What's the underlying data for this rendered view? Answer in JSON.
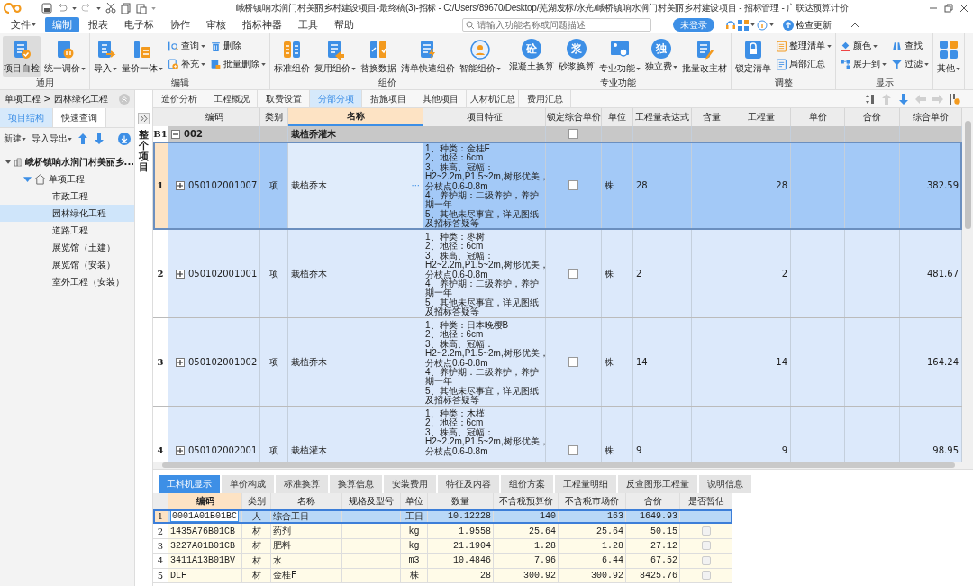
{
  "app": {
    "title": "峨桥镇响水涧门村美丽乡村建设项目-最终稿(3)-招标 - C:/Users/89670/Desktop/芜湖发标/永光/峨桥镇响水涧门村美丽乡村建设项目 - 招标管理 - 广联达预算计价"
  },
  "menu": {
    "items": [
      {
        "label": "文件",
        "menu": true,
        "selected": false
      },
      {
        "label": "编制",
        "menu": false,
        "selected": true
      },
      {
        "label": "报表",
        "menu": false,
        "selected": false
      },
      {
        "label": "电子标",
        "menu": false,
        "selected": false
      },
      {
        "label": "协作",
        "menu": false,
        "selected": false
      },
      {
        "label": "审核",
        "menu": false,
        "selected": false
      },
      {
        "label": "指标神器",
        "menu": false,
        "selected": false
      },
      {
        "label": "工具",
        "menu": false,
        "selected": false
      },
      {
        "label": "帮助",
        "menu": false,
        "selected": false
      }
    ],
    "search": {
      "placeholder": "请输入功能名称或问题描述"
    },
    "login": "未登录",
    "update": "检查更新"
  },
  "ribbon": [
    {
      "label": "通用",
      "columns": [
        {
          "kind": "large",
          "label": "项目自检",
          "menu": false,
          "pressed": true
        },
        {
          "kind": "large",
          "label": "统一调价",
          "menu": true,
          "pressed": false
        }
      ]
    },
    {
      "label": "编辑",
      "columns": [
        {
          "kind": "large",
          "label": "导入",
          "menu": true,
          "pressed": false
        },
        {
          "kind": "large",
          "label": "量价一体",
          "menu": true,
          "pressed": false
        },
        {
          "kind": "stack",
          "items": [
            {
              "label": "查询",
              "menu": true
            },
            {
              "label": "补充",
              "menu": true
            }
          ]
        },
        {
          "kind": "stack",
          "items": [
            {
              "label": "删除",
              "menu": false
            },
            {
              "label": "批量删除",
              "menu": true
            }
          ]
        }
      ]
    },
    {
      "label": "组价",
      "columns": [
        {
          "kind": "large",
          "label": "标准组价",
          "menu": false,
          "pressed": false
        },
        {
          "kind": "large",
          "label": "复用组价",
          "menu": true,
          "pressed": false
        },
        {
          "kind": "large",
          "label": "替换数据",
          "menu": false,
          "pressed": false
        },
        {
          "kind": "large",
          "label": "清单快速组价",
          "menu": false,
          "pressed": false
        },
        {
          "kind": "large",
          "label": "智能组价",
          "menu": true,
          "pressed": false
        }
      ]
    },
    {
      "label": "专业功能",
      "columns": [
        {
          "kind": "large",
          "label": "混凝土换算",
          "glyph": "砼",
          "menu": false,
          "pressed": false
        },
        {
          "kind": "large",
          "label": "砂浆换算",
          "glyph": "浆",
          "menu": false,
          "pressed": false
        },
        {
          "kind": "large",
          "label": "专业功能",
          "menu": true,
          "pressed": false
        },
        {
          "kind": "large",
          "label": "独立费",
          "glyph": "独",
          "menu": true,
          "pressed": false
        },
        {
          "kind": "large",
          "label": "批量改主材",
          "menu": false,
          "pressed": false
        }
      ]
    },
    {
      "label": "调整",
      "columns": [
        {
          "kind": "large",
          "label": "锁定清单",
          "menu": false,
          "pressed": false
        },
        {
          "kind": "stack",
          "items": [
            {
              "label": "整理清单",
              "menu": true
            },
            {
              "label": "局部汇总",
              "menu": false
            }
          ]
        }
      ]
    },
    {
      "label": "显示",
      "columns": [
        {
          "kind": "stack",
          "items": [
            {
              "label": "颜色",
              "menu": true
            },
            {
              "label": "展开到",
              "menu": true
            }
          ]
        },
        {
          "kind": "stack",
          "items": [
            {
              "label": "查找",
              "menu": false
            },
            {
              "label": "过滤",
              "menu": true
            }
          ]
        }
      ]
    },
    {
      "columns": [
        {
          "kind": "large",
          "label": "其他",
          "menu": true,
          "pressed": false
        }
      ]
    }
  ],
  "sidebar": {
    "breadcrumb": "单项工程 > 园林绿化工程",
    "tabs": [
      {
        "label": "项目结构",
        "selected": true
      },
      {
        "label": "快速查询",
        "selected": false
      }
    ],
    "toolbar": [
      {
        "label": "新建",
        "menu": true
      },
      {
        "label": "导入导出",
        "menu": true
      }
    ],
    "tree": [
      {
        "label": "峨桥镇响水涧门村美丽乡...",
        "kind": "project",
        "expanded": true,
        "selected": false,
        "children": [
          {
            "label": "单项工程",
            "kind": "single",
            "expanded": true,
            "selected": false,
            "children": [
              {
                "label": "市政工程",
                "selected": false
              },
              {
                "label": "园林绿化工程",
                "selected": true
              },
              {
                "label": "道路工程",
                "selected": false
              },
              {
                "label": "展览馆（土建）",
                "selected": false
              },
              {
                "label": "展览馆（安装）",
                "selected": false
              },
              {
                "label": "室外工程（安装）",
                "selected": false
              }
            ]
          }
        ]
      }
    ]
  },
  "side_strip": {
    "label": "整个项目"
  },
  "view_tabs": [
    {
      "label": "造价分析",
      "selected": false
    },
    {
      "label": "工程概况",
      "selected": false
    },
    {
      "label": "取费设置",
      "selected": false
    },
    {
      "label": "分部分项",
      "selected": true
    },
    {
      "label": "措施项目",
      "selected": false
    },
    {
      "label": "其他项目",
      "selected": false
    },
    {
      "label": "人材机汇总",
      "selected": false
    },
    {
      "label": "费用汇总",
      "selected": false
    }
  ],
  "table_toolbar": [
    {
      "kind": "sort",
      "disabled": false
    },
    {
      "kind": "up",
      "disabled": true
    },
    {
      "kind": "down",
      "disabled": false
    },
    {
      "kind": "left",
      "disabled": true
    },
    {
      "kind": "right",
      "disabled": true
    },
    {
      "kind": "columns",
      "disabled": false
    }
  ],
  "table": {
    "columns": [
      {
        "label": "编码",
        "selected": false
      },
      {
        "label": "类别",
        "selected": false
      },
      {
        "label": "名称",
        "selected": true
      },
      {
        "label": "项目特征",
        "selected": false
      },
      {
        "label": "锁定综合单价",
        "selected": false
      },
      {
        "label": "单位",
        "selected": false
      },
      {
        "label": "工程量表达式",
        "selected": false
      },
      {
        "label": "含量",
        "selected": false
      },
      {
        "label": "工程量",
        "selected": false
      },
      {
        "label": "单价",
        "selected": false
      },
      {
        "label": "合价",
        "selected": false
      },
      {
        "label": "综合单价",
        "selected": false
      }
    ],
    "section": {
      "index": "B1",
      "code": "002",
      "name": "栽植乔灌木",
      "expanded": true,
      "lock_checked": false
    },
    "rows": [
      {
        "index": "1",
        "code": "050102001007",
        "expanded": false,
        "type": "项",
        "name": "栽植乔木",
        "more": "···",
        "feature": [
          "1、种类：金桂F",
          "2、地径：6cm",
          "3、株高、冠幅：",
          "H2~2.2m,P1.5~2m,树形优美，",
          "分枝点0.6-0.8m",
          "4、养护期：二级养护，养护",
          "期一年",
          "5、其他未尽事宜，详见图纸",
          "及招标答疑等"
        ],
        "lock_checked": false,
        "unit": "株",
        "expression": "28",
        "quantity": "28",
        "composite_price": "382.59",
        "selected": true
      },
      {
        "index": "2",
        "code": "050102001001",
        "expanded": false,
        "type": "项",
        "name": "栽植乔木",
        "feature": [
          "1、种类：枣树",
          "2、地径：6cm",
          "3、株高、冠幅：",
          "H2~2.2m,P1.5~2m,树形优美，",
          "分枝点0.6-0.8m",
          "4、养护期：二级养护，养护",
          "期一年",
          "5、其他未尽事宜，详见图纸",
          "及招标答疑等"
        ],
        "lock_checked": false,
        "unit": "株",
        "expression": "2",
        "quantity": "2",
        "composite_price": "481.67",
        "selected": false
      },
      {
        "index": "3",
        "code": "050102001002",
        "expanded": false,
        "type": "项",
        "name": "栽植乔木",
        "feature": [
          "1、种类：日本晚樱B",
          "2、地径：6cm",
          "3、株高、冠幅：",
          "H2~2.2m,P1.5~2m,树形优美，",
          "分枝点0.6-0.8m",
          "4、养护期：二级养护，养护",
          "期一年",
          "5、其他未尽事宜，详见图纸",
          "及招标答疑等"
        ],
        "lock_checked": false,
        "unit": "株",
        "expression": "14",
        "quantity": "14",
        "composite_price": "164.24",
        "selected": false
      },
      {
        "index": "4",
        "code": "050102002001",
        "expanded": false,
        "type": "项",
        "name": "栽植灌木",
        "feature": [
          "1、种类：木槿",
          "2、地径：6cm",
          "3、株高、冠幅：",
          "H2~2.2m,P1.5~2m,树形优美，",
          "分枝点0.6-0.8m"
        ],
        "lock_checked": false,
        "unit": "株",
        "expression": "9",
        "quantity": "9",
        "composite_price": "98.95",
        "selected": false
      }
    ]
  },
  "detail": {
    "tabs": [
      {
        "label": "工料机显示",
        "selected": true
      },
      {
        "label": "单价构成",
        "selected": false
      },
      {
        "label": "标准换算",
        "selected": false
      },
      {
        "label": "换算信息",
        "selected": false
      },
      {
        "label": "安装费用",
        "selected": false
      },
      {
        "label": "特征及内容",
        "selected": false
      },
      {
        "label": "组价方案",
        "selected": false
      },
      {
        "label": "工程量明细",
        "selected": false
      },
      {
        "label": "反查图形工程量",
        "selected": false
      },
      {
        "label": "说明信息",
        "selected": false
      }
    ],
    "columns": [
      {
        "label": "编码",
        "selected": true
      },
      {
        "label": "类别",
        "selected": false
      },
      {
        "label": "名称",
        "selected": false
      },
      {
        "label": "规格及型号",
        "selected": false
      },
      {
        "label": "单位",
        "selected": false
      },
      {
        "label": "数量",
        "selected": false
      },
      {
        "label": "不含税预算价",
        "selected": false
      },
      {
        "label": "不含税市场价",
        "selected": false
      },
      {
        "label": "合价",
        "selected": false
      },
      {
        "label": "是否暂估",
        "selected": false
      }
    ],
    "rows": [
      {
        "index": "1",
        "code": "0001A01B01BC",
        "type": "人",
        "name": "综合工日",
        "unit": "工日",
        "amount": "10.12228",
        "budget_price": "140",
        "market_price": "163",
        "total": "1649.93",
        "selected": true
      },
      {
        "index": "2",
        "code": "1435A76B01CB",
        "type": "材",
        "name": "药剂",
        "unit": "kg",
        "amount": "1.9558",
        "budget_price": "25.64",
        "market_price": "25.64",
        "total": "50.15",
        "selected": false,
        "provisional_checked": false
      },
      {
        "index": "3",
        "code": "3227A01B01CB",
        "type": "材",
        "name": "肥料",
        "unit": "kg",
        "amount": "21.1904",
        "budget_price": "1.28",
        "market_price": "1.28",
        "total": "27.12",
        "selected": false,
        "provisional_checked": false
      },
      {
        "index": "4",
        "code": "3411A13B01BV",
        "type": "材",
        "name": "水",
        "unit": "m3",
        "amount": "10.4846",
        "budget_price": "7.96",
        "market_price": "6.44",
        "total": "67.52",
        "selected": false,
        "provisional_checked": false
      },
      {
        "index": "5",
        "code": "DLF",
        "type": "材",
        "name": "金桂F",
        "unit": "株",
        "amount": "28",
        "budget_price": "300.92",
        "market_price": "300.92",
        "total": "8425.76",
        "selected": false,
        "provisional_checked": false
      }
    ]
  }
}
